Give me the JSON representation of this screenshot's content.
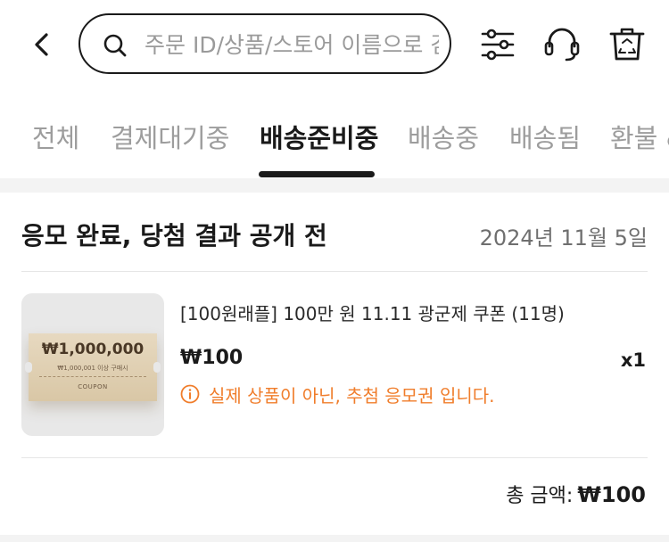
{
  "header": {
    "search_placeholder": "주문 ID/상품/스토어 이름으로 검색",
    "icons": [
      "back-arrow-icon",
      "search-icon",
      "filter-sliders-icon",
      "headset-icon",
      "trash-icon"
    ]
  },
  "tabs": [
    {
      "label": "전체",
      "active": false
    },
    {
      "label": "결제대기중",
      "active": false
    },
    {
      "label": "배송준비중",
      "active": true
    },
    {
      "label": "배송중",
      "active": false
    },
    {
      "label": "배송됨",
      "active": false
    },
    {
      "label": "환불 &",
      "active": false
    }
  ],
  "order": {
    "status": "응모 완료, 당첨 결과 공개 전",
    "date": "2024년 11월 5일",
    "item": {
      "name": "[100원래플] 100만 원 11.11 광군제 쿠폰 (11명)",
      "price": "₩100",
      "quantity": "x1",
      "notice": "실제 상품이 아닌, 추첨 응모권 입니다.",
      "thumbnail": {
        "amount": "₩1,000,000",
        "subtitle": "₩1,000,001 이상 구매시",
        "label": "COUPON"
      }
    },
    "total_label": "총 금액:",
    "total_value": "₩100"
  },
  "colors": {
    "accent_orange": "#f07d2b",
    "text_primary": "#1a1a1a",
    "text_muted": "#9d9d9d",
    "separator": "#f3f3f3"
  }
}
